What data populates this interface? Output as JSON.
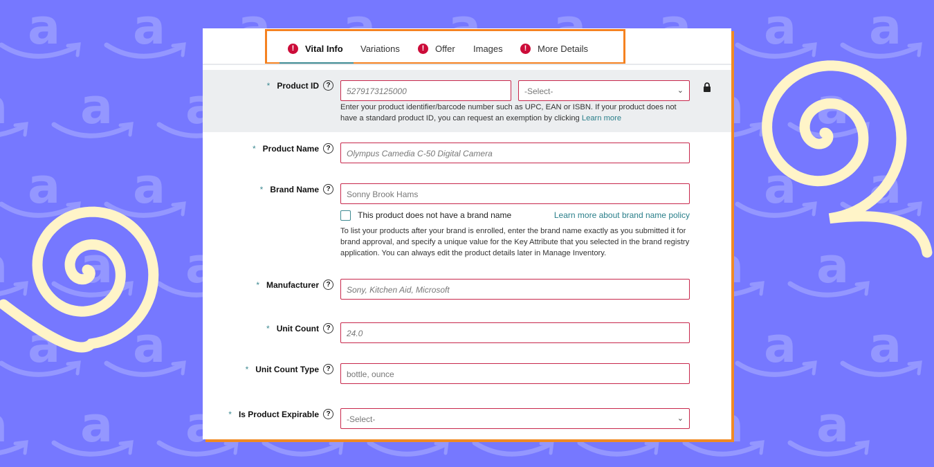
{
  "colors": {
    "background": "#7678ff",
    "pattern": "#9497ff",
    "spiral": "#fff4c8",
    "accent": "#f58220",
    "alert": "#cc0c39",
    "link": "#2a7f8a"
  },
  "tabs": [
    {
      "label": "Vital Info",
      "alert": true,
      "active": true
    },
    {
      "label": "Variations",
      "alert": false
    },
    {
      "label": "Offer",
      "alert": true
    },
    {
      "label": "Images",
      "alert": false
    },
    {
      "label": "More Details",
      "alert": true
    }
  ],
  "alert_glyph": "!",
  "help_glyph": "?",
  "required_mark": "*",
  "fields": {
    "product_id": {
      "label": "Product ID",
      "placeholder": "5279173125000",
      "type_select": "-Select-",
      "help": "Enter your product identifier/barcode number such as UPC, EAN or ISBN. If your product does not have a standard product ID, you can request an exemption by clicking",
      "help_link": "Learn more"
    },
    "product_name": {
      "label": "Product Name",
      "placeholder": "Olympus Camedia C-50 Digital Camera"
    },
    "brand_name": {
      "label": "Brand Name",
      "placeholder": "Sonny Brook Hams",
      "checkbox_label": "This product does not have a brand name",
      "policy_link": "Learn more about brand name policy",
      "help": "To list your products after your brand is enrolled, enter the brand name exactly as you submitted it for brand approval, and specify a unique value for the Key Attribute that you selected in the brand registry application. You can always edit the product details later in Manage Inventory."
    },
    "manufacturer": {
      "label": "Manufacturer",
      "placeholder": "Sony, Kitchen Aid, Microsoft"
    },
    "unit_count": {
      "label": "Unit Count",
      "placeholder": "24.0"
    },
    "unit_count_type": {
      "label": "Unit Count Type",
      "placeholder": "bottle, ounce"
    },
    "is_product_expirable": {
      "label": "Is Product Expirable",
      "value": "-Select-"
    }
  }
}
